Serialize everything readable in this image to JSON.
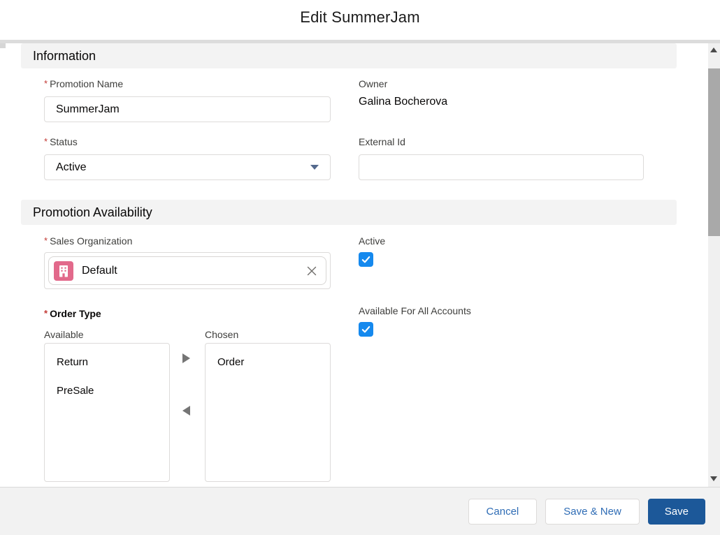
{
  "ui": {
    "required_marker": "*"
  },
  "modal": {
    "title": "Edit SummerJam",
    "sections": {
      "information": "Information",
      "promotion_availability": "Promotion Availability"
    }
  },
  "fields": {
    "promotion_name": {
      "label": "Promotion Name",
      "required": true,
      "value": "SummerJam"
    },
    "owner": {
      "label": "Owner",
      "value": "Galina Bocherova"
    },
    "status": {
      "label": "Status",
      "required": true,
      "value": "Active"
    },
    "external_id": {
      "label": "External Id",
      "value": ""
    },
    "sales_organization": {
      "label": "Sales Organization",
      "required": true,
      "selected_record": "Default"
    },
    "active": {
      "label": "Active",
      "checked": true
    },
    "order_type": {
      "label": "Order Type",
      "required": true,
      "available_label": "Available",
      "chosen_label": "Chosen",
      "available_options": [
        "Return",
        "PreSale"
      ],
      "chosen_options": [
        "Order"
      ]
    },
    "available_for_all_accounts": {
      "label": "Available For All Accounts",
      "checked": true
    }
  },
  "footer": {
    "cancel_label": "Cancel",
    "save_new_label": "Save & New",
    "save_label": "Save"
  },
  "colors": {
    "checkbox_blue": "#1589ee",
    "save_button_blue": "#1c5899",
    "neutral_button_text_blue": "#2e6cb5",
    "required_red": "#c23934",
    "sales_org_icon_pink": "#e2698b",
    "section_header_bg": "#f3f3f3",
    "footer_bg": "#f2f2f2"
  }
}
